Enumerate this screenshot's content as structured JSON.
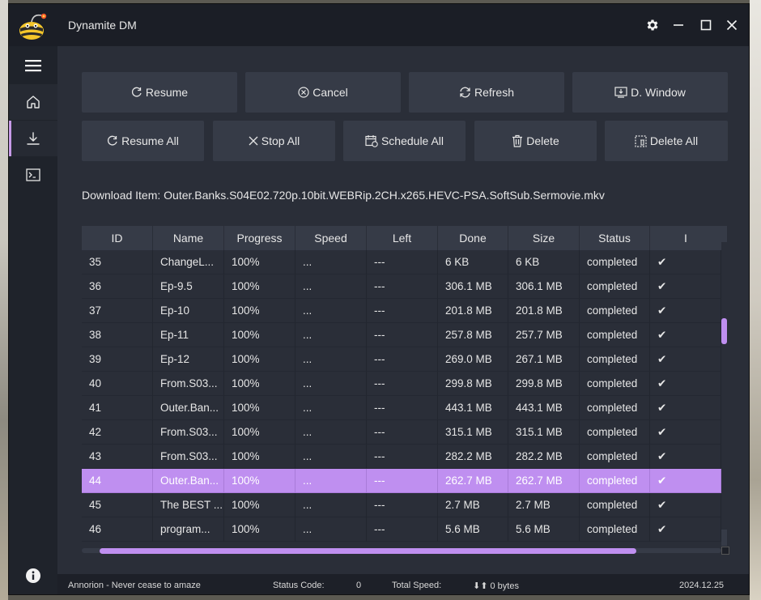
{
  "window": {
    "title": "Dynamite DM"
  },
  "sidebar": {
    "items": [
      "menu",
      "home",
      "downloads",
      "terminal",
      "info"
    ]
  },
  "toolbar": {
    "row1": [
      "Resume",
      "Cancel",
      "Refresh",
      "D. Window"
    ],
    "row2": [
      "Resume All",
      "Stop All",
      "Schedule All",
      "Delete",
      "Delete All"
    ]
  },
  "download_item": "Download Item: Outer.Banks.S04E02.720p.10bit.WEBRip.2CH.x265.HEVC-PSA.SoftSub.Sermovie.mkv",
  "table": {
    "headers": [
      "ID",
      "Name",
      "Progress",
      "Speed",
      "Left",
      "Done",
      "Size",
      "Status",
      "I"
    ],
    "rows": [
      [
        "35",
        "ChangeL...",
        "100%",
        "...",
        "---",
        "6 KB",
        "6 KB",
        "completed",
        "✔"
      ],
      [
        "36",
        "Ep-9.5",
        "100%",
        "...",
        "---",
        "306.1 MB",
        "306.1 MB",
        "completed",
        "✔"
      ],
      [
        "37",
        "Ep-10",
        "100%",
        "...",
        "---",
        "201.8 MB",
        "201.8 MB",
        "completed",
        "✔"
      ],
      [
        "38",
        "Ep-11",
        "100%",
        "...",
        "---",
        "257.8 MB",
        "257.7 MB",
        "completed",
        "✔"
      ],
      [
        "39",
        "Ep-12",
        "100%",
        "...",
        "---",
        "269.0 MB",
        "267.1 MB",
        "completed",
        "✔"
      ],
      [
        "40",
        "From.S03...",
        "100%",
        "...",
        "---",
        "299.8 MB",
        "299.8 MB",
        "completed",
        "✔"
      ],
      [
        "41",
        "Outer.Ban...",
        "100%",
        "...",
        "---",
        "443.1 MB",
        "443.1 MB",
        "completed",
        "✔"
      ],
      [
        "42",
        "From.S03...",
        "100%",
        "...",
        "---",
        "315.1 MB",
        "315.1 MB",
        "completed",
        "✔"
      ],
      [
        "43",
        "From.S03...",
        "100%",
        "...",
        "---",
        "282.2 MB",
        "282.2 MB",
        "completed",
        "✔"
      ],
      [
        "44",
        "Outer.Ban...",
        "100%",
        "...",
        "---",
        "262.7 MB",
        "262.7 MB",
        "completed",
        "✔"
      ],
      [
        "45",
        "The BEST ...",
        "100%",
        "...",
        "---",
        "2.7 MB",
        "2.7 MB",
        "completed",
        "✔"
      ],
      [
        "46",
        "program...",
        "100%",
        "...",
        "---",
        "5.6 MB",
        "5.6 MB",
        "completed",
        "✔"
      ]
    ],
    "selected_index": 9
  },
  "statusbar": {
    "tagline": "Annorion - Never cease to amaze",
    "status_code_label": "Status Code:",
    "status_code_value": "0",
    "total_speed_label": "Total Speed:",
    "total_speed_value": "⬇⬆ 0 bytes",
    "version": "2024.12.25"
  },
  "colors": {
    "accent": "#bf8ff0",
    "background": "#2a2e38",
    "button": "#363b47"
  }
}
